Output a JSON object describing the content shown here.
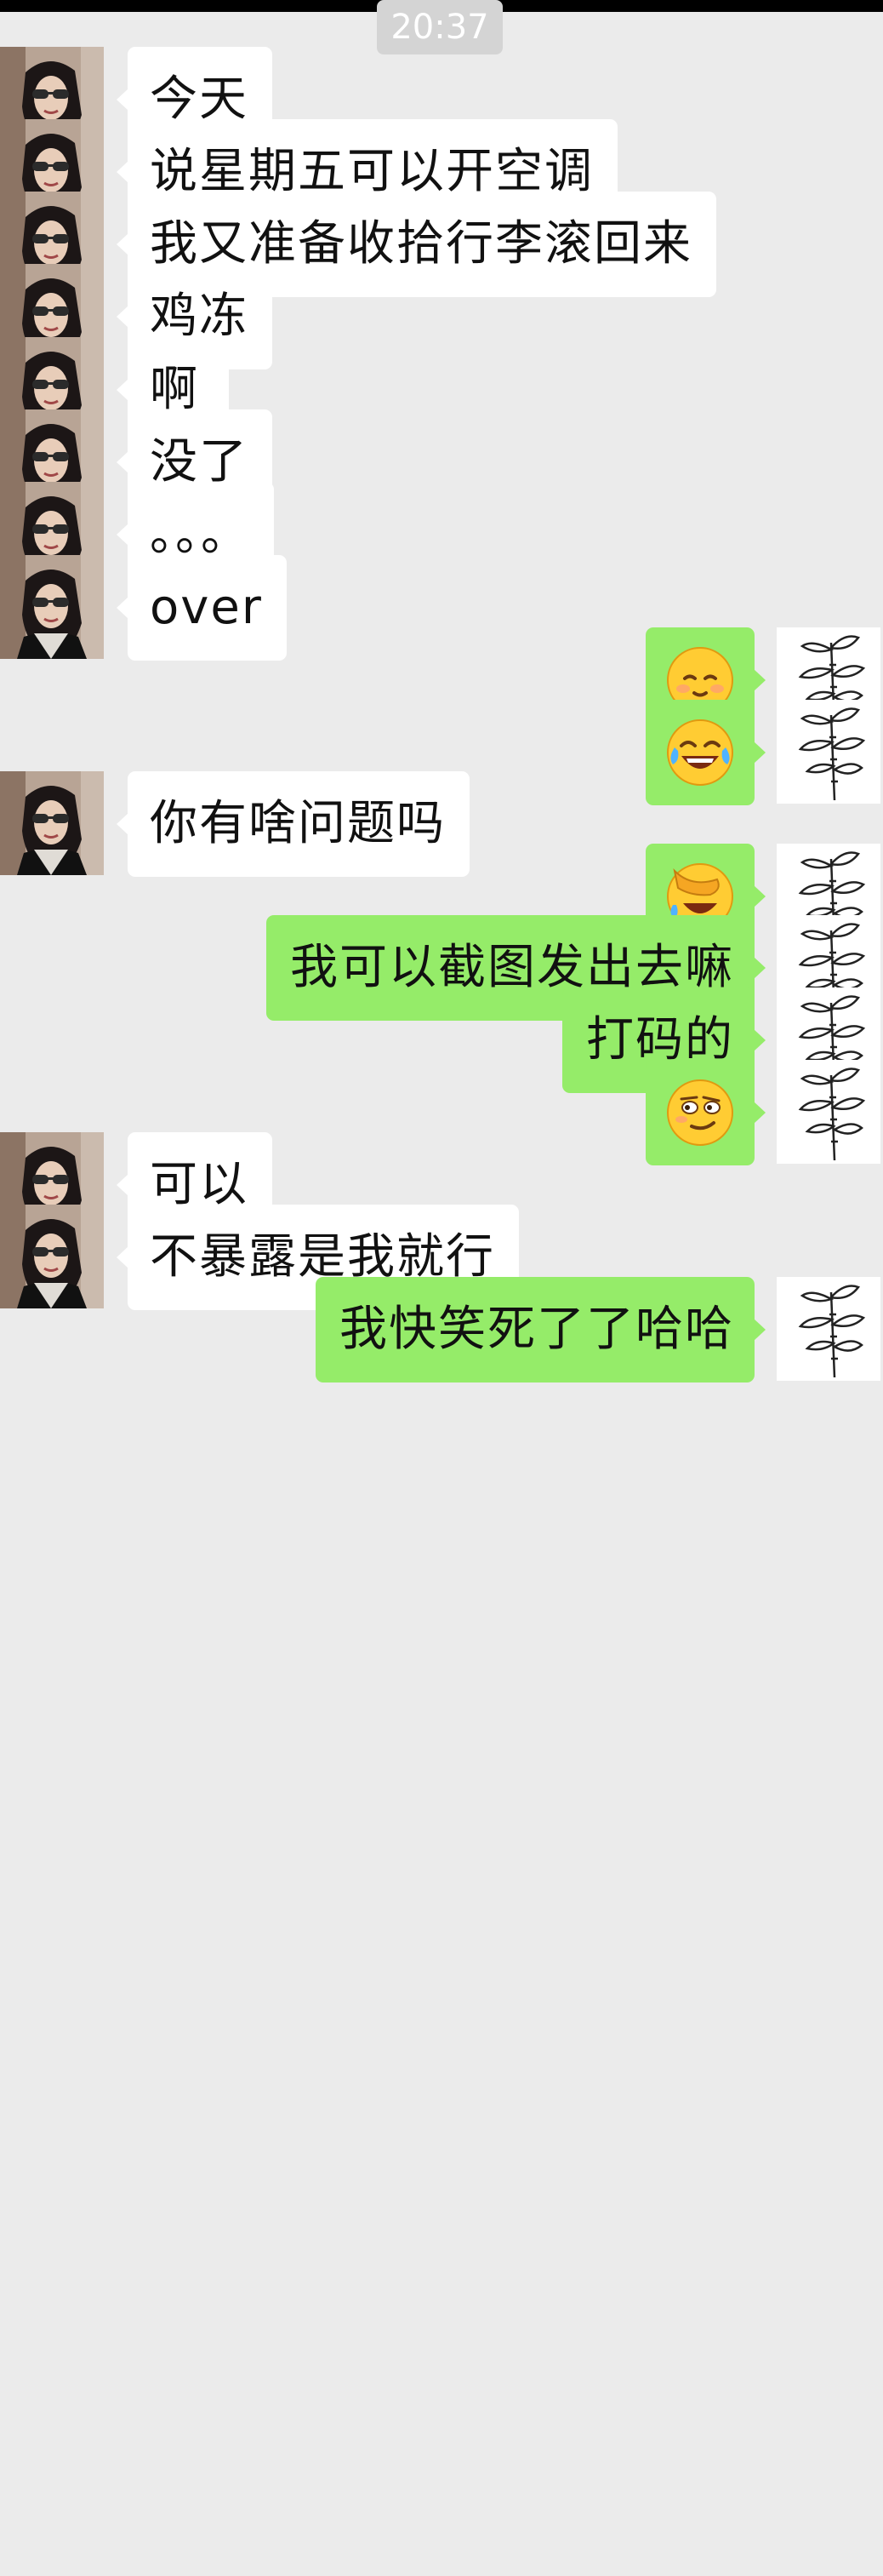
{
  "chat": {
    "timestamp": "20:37",
    "messages": [
      {
        "side": "left",
        "type": "text",
        "text": "今天"
      },
      {
        "side": "left",
        "type": "text",
        "text": "说星期五可以开空调"
      },
      {
        "side": "left",
        "type": "text",
        "text": "我又准备收拾行李滚回来"
      },
      {
        "side": "left",
        "type": "text",
        "text": "鸡冻"
      },
      {
        "side": "left",
        "type": "text",
        "text": "啊"
      },
      {
        "side": "left",
        "type": "text",
        "text": "没了"
      },
      {
        "side": "left",
        "type": "text",
        "text": "。。。"
      },
      {
        "side": "left",
        "type": "text",
        "text": "over"
      },
      {
        "side": "right",
        "type": "emoji",
        "emoji": "shy-smile-emoji"
      },
      {
        "side": "right",
        "type": "emoji",
        "emoji": "tears-of-joy-emoji"
      },
      {
        "side": "left",
        "type": "text",
        "text": "你有啥问题吗"
      },
      {
        "side": "right",
        "type": "emoji",
        "emoji": "facepalm-laugh-emoji"
      },
      {
        "side": "right",
        "type": "text",
        "text": "我可以截图发出去嘛"
      },
      {
        "side": "right",
        "type": "text",
        "text": "打码的"
      },
      {
        "side": "right",
        "type": "emoji",
        "emoji": "smirk-emoji"
      },
      {
        "side": "left",
        "type": "text",
        "text": "可以"
      },
      {
        "side": "left",
        "type": "text",
        "text": "不暴露是我就行"
      },
      {
        "side": "right",
        "type": "text",
        "text": "我快笑死了了哈哈"
      }
    ]
  },
  "colors": {
    "background": "#ebebeb",
    "incoming_bubble": "#ffffff",
    "outgoing_bubble": "#95ec69",
    "timestamp_bg": "#d4d4d4"
  }
}
